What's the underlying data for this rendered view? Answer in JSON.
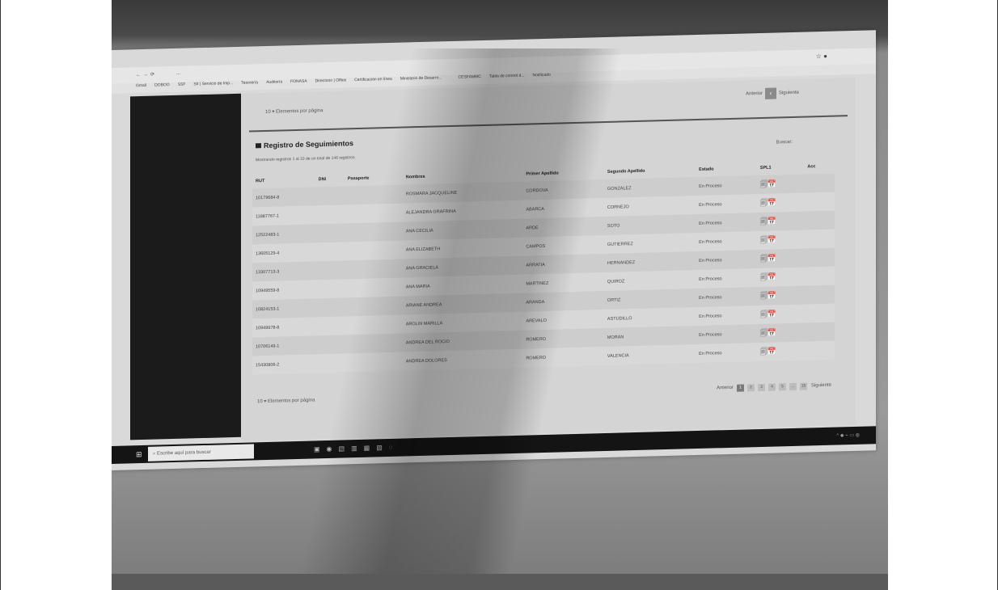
{
  "browser": {
    "url": "...",
    "bookmarks": [
      "Gmail",
      "DOBOO",
      "SSF",
      "SII | Servicio de Imp...",
      "Tesorería",
      "Auditoría",
      "FONASA",
      "Directorio | Office",
      "Certificación en línea",
      "Ministerio de Desarro...",
      "",
      "CESFAMMC",
      "Tabla de control d...",
      "Notificado"
    ]
  },
  "top_controls": {
    "per_page_value": "10",
    "per_page_label": "Elementos por página",
    "prev_label": "Anterior",
    "next_label": "Siguiente"
  },
  "section": {
    "title": "Registro de Seguimientos",
    "subtitle": "Mostrando registros 1 al 10 de un total de 146 registros",
    "search_label": "Buscar:"
  },
  "table": {
    "columns": [
      "RUT",
      "DNI",
      "Pasaporte",
      "Nombres",
      "Primer Apellido",
      "Segundo Apellido",
      "Estado",
      "SPL1",
      "Acc"
    ],
    "rows": [
      {
        "rut": "10179684-8",
        "dni": "",
        "pasaporte": "",
        "nombres": "ROSMARA JACQUELINE",
        "primer": "CORDOVA",
        "segundo": "GONZALEZ",
        "estado": "En Proceso"
      },
      {
        "rut": "11887767-1",
        "dni": "",
        "pasaporte": "",
        "nombres": "ALEJANDRA GRAFRINA",
        "primer": "ABARCA",
        "segundo": "CORNEJO",
        "estado": "En Proceso"
      },
      {
        "rut": "12522483-1",
        "dni": "",
        "pasaporte": "",
        "nombres": "ANA CECILIA",
        "primer": "ARDE",
        "segundo": "SOTO",
        "estado": "En Proceso"
      },
      {
        "rut": "13605129-4",
        "dni": "",
        "pasaporte": "",
        "nombres": "ANA ELIZABETH",
        "primer": "CAMPOS",
        "segundo": "GUTIERREZ",
        "estado": "En Proceso"
      },
      {
        "rut": "13307713-3",
        "dni": "",
        "pasaporte": "",
        "nombres": "ANA GRACIELA",
        "primer": "ARRATIA",
        "segundo": "HERNANDEZ",
        "estado": "En Proceso"
      },
      {
        "rut": "10949559-8",
        "dni": "",
        "pasaporte": "",
        "nombres": "ANA MARIA",
        "primer": "MARTINEZ",
        "segundo": "QUIROZ",
        "estado": "En Proceso"
      },
      {
        "rut": "10824153-1",
        "dni": "",
        "pasaporte": "",
        "nombres": "ARIANE ANDREA",
        "primer": "ARANDA",
        "segundo": "ORTIZ",
        "estado": "En Proceso"
      },
      {
        "rut": "10949978-8",
        "dni": "",
        "pasaporte": "",
        "nombres": "AROLIN MARILLA",
        "primer": "AREVALO",
        "segundo": "ASTUDILLO",
        "estado": "En Proceso"
      },
      {
        "rut": "10706149-1",
        "dni": "",
        "pasaporte": "",
        "nombres": "ANDREA DEL ROCIO",
        "primer": "ROMERO",
        "segundo": "MORAN",
        "estado": "En Proceso"
      },
      {
        "rut": "15430806-2",
        "dni": "",
        "pasaporte": "",
        "nombres": "ANDREA DOLORES",
        "primer": "ROMERO",
        "segundo": "VALENCIA",
        "estado": "En Proceso"
      }
    ]
  },
  "bottom_controls": {
    "per_page_value": "10",
    "per_page_label": "Elementos por página",
    "prev_label": "Anterior",
    "pages": [
      "1",
      "2",
      "3",
      "4",
      "5",
      "...",
      "15"
    ],
    "next_label": "Siguiente"
  },
  "taskbar": {
    "search_placeholder": "Escribe aquí para buscar"
  }
}
